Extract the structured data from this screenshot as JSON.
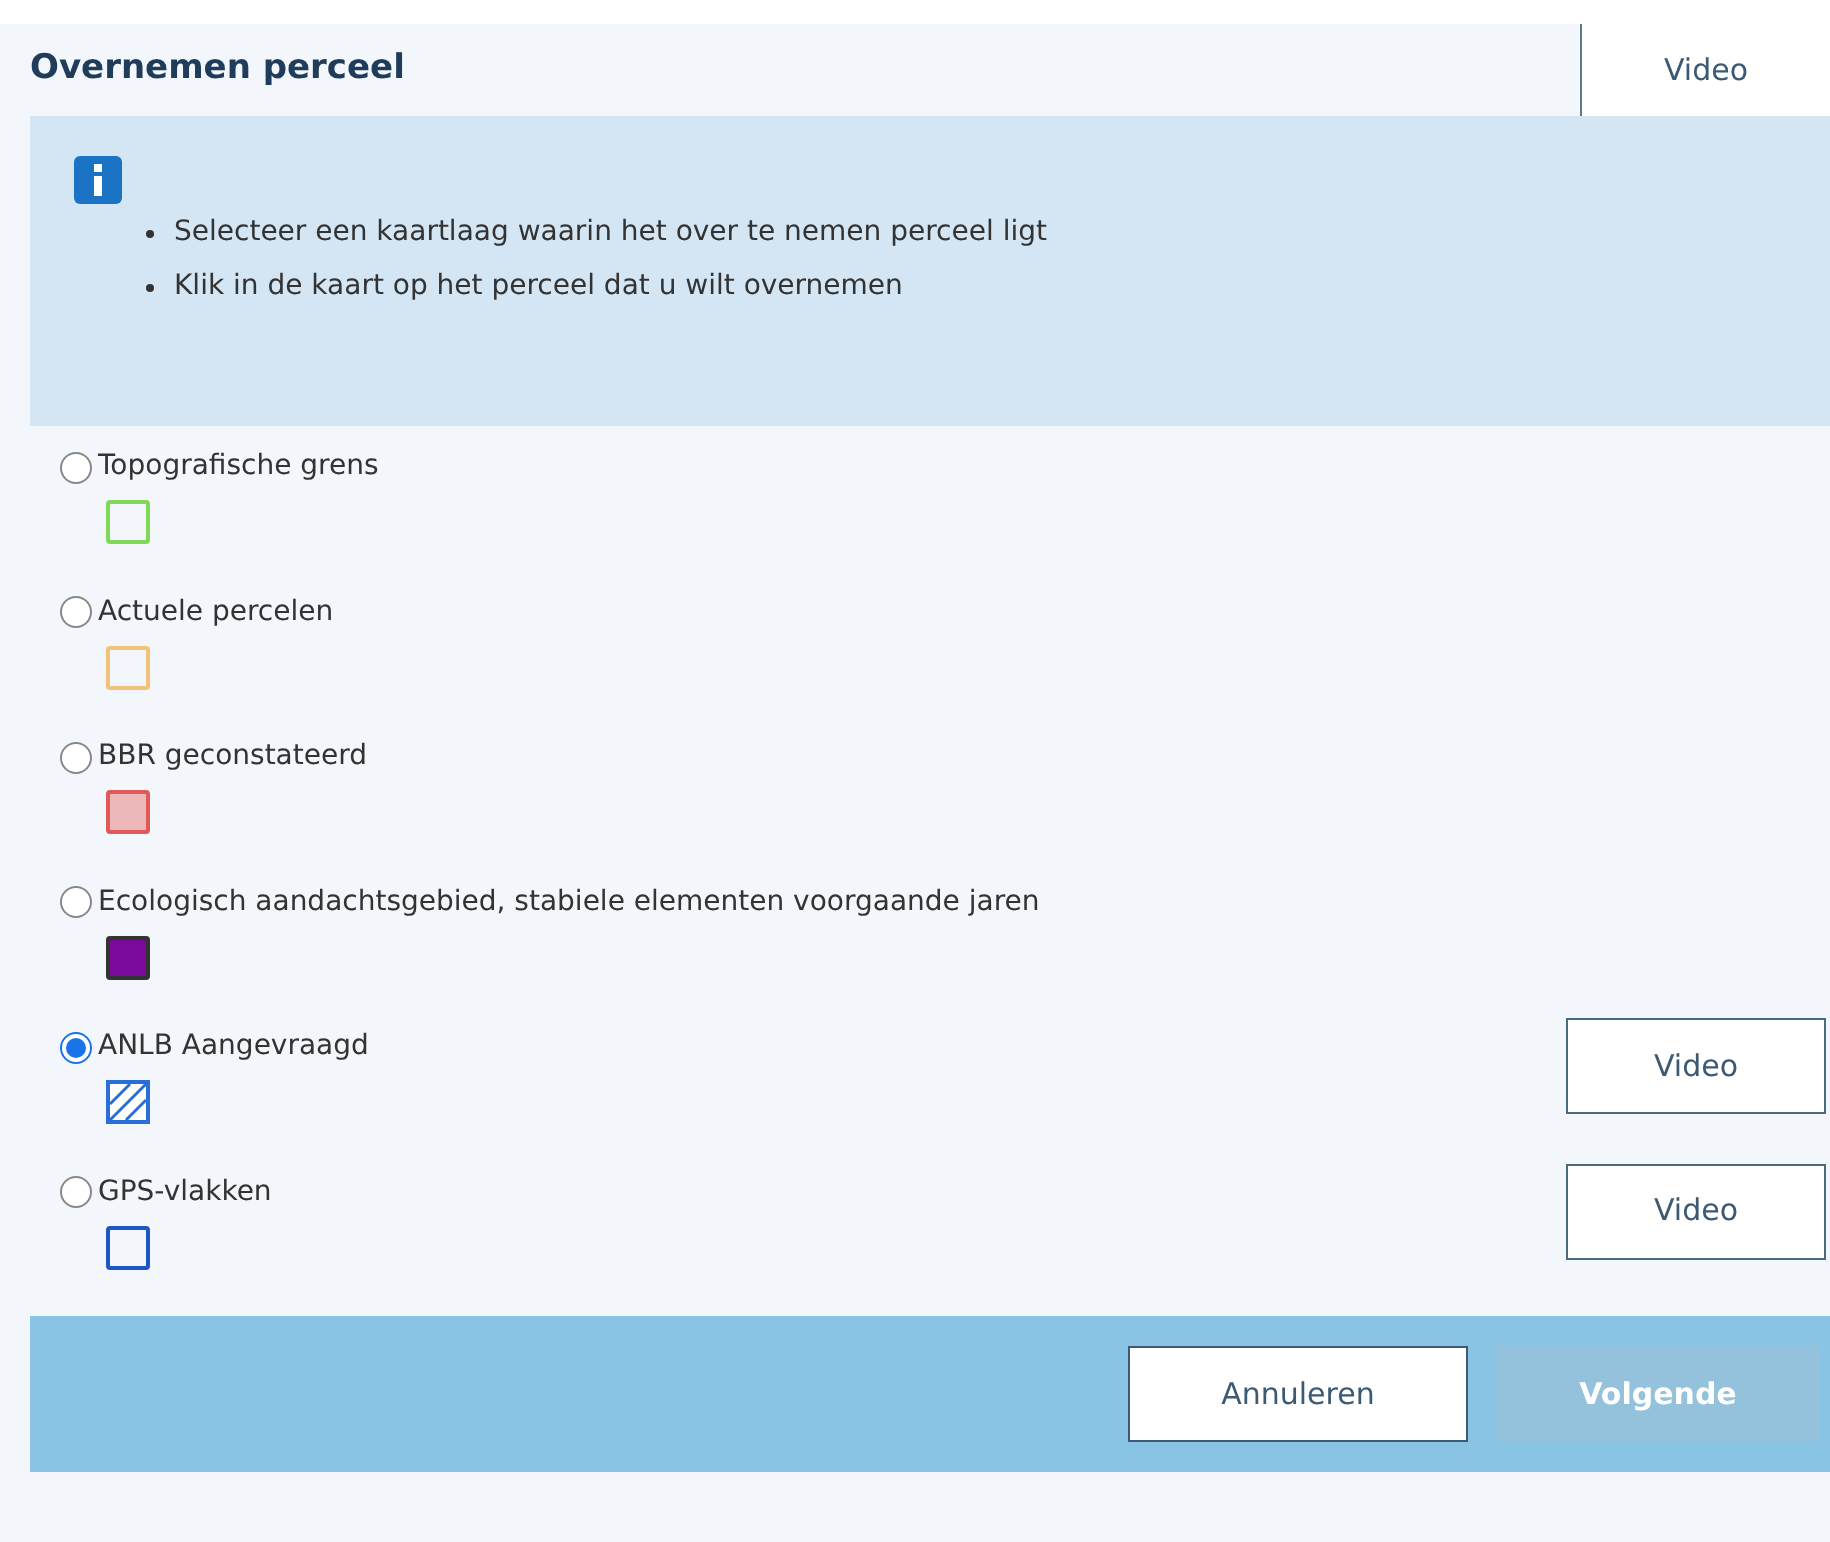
{
  "title": "Overnemen perceel",
  "header_tab": {
    "label": "Video"
  },
  "info": {
    "bullets": [
      "Selecteer een kaartlaag waarin het over te nemen perceel ligt",
      "Klik in de kaart op het perceel dat u wilt overnemen"
    ]
  },
  "layers": [
    {
      "label": "Topografische grens",
      "selected": false,
      "kind": "outline",
      "color": "#7ed957"
    },
    {
      "label": "Actuele percelen",
      "selected": false,
      "kind": "outline",
      "color": "#f0c27a"
    },
    {
      "label": "BBR geconstateerd",
      "selected": false,
      "kind": "tinted",
      "color": "#e05a5a"
    },
    {
      "label": "Ecologisch aandachtsgebied, stabiele elementen voorgaande jaren",
      "selected": false,
      "kind": "filled",
      "color": "#7a0a9a"
    },
    {
      "label": "ANLB Aangevraagd",
      "selected": true,
      "kind": "hatched",
      "color": "#2a6fd6",
      "video_button": "Video"
    },
    {
      "label": "GPS-vlakken",
      "selected": false,
      "kind": "outline",
      "color": "#1f55c8",
      "video_button": "Video"
    }
  ],
  "footer": {
    "buttons": [
      {
        "label": "Annuleren",
        "disabled": false
      },
      {
        "label": "Volgende",
        "disabled": true
      }
    ]
  }
}
